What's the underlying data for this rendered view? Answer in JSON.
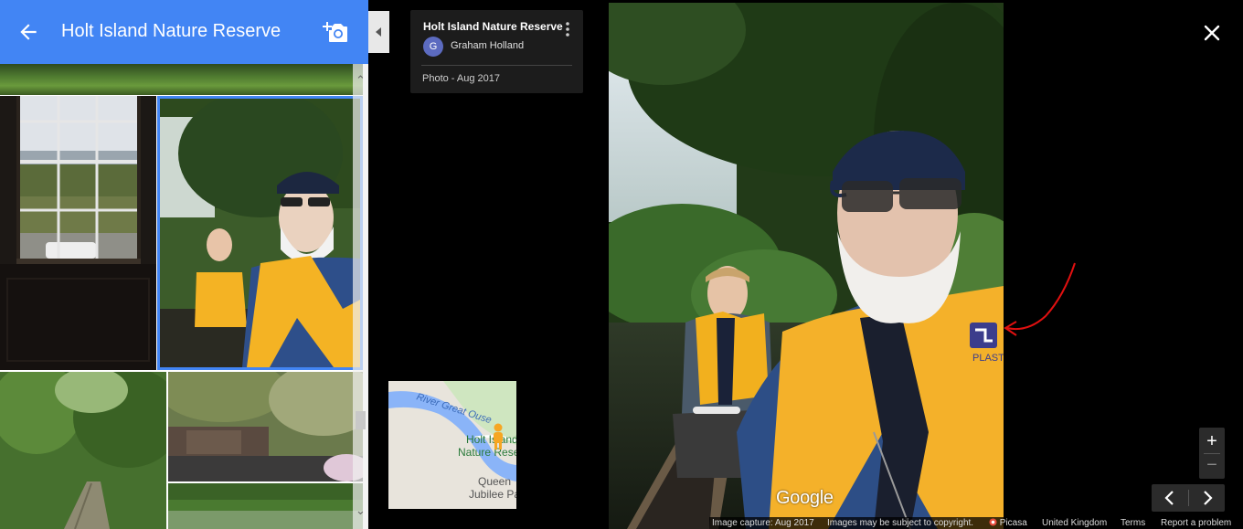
{
  "header": {
    "title": "Holt Island Nature Reserve"
  },
  "info_card": {
    "title": "Holt Island Nature Reserve",
    "author_initial": "G",
    "author_name": "Graham Holland",
    "photo_date": "Photo - Aug 2017"
  },
  "mini_map": {
    "river_label": "River Great Ouse",
    "place_label_line1": "Holt Island",
    "place_label_line2": "Nature Reserve",
    "park_label_line1": "Queen",
    "park_label_line2": "Jubilee Park"
  },
  "photo": {
    "watermark": "Google",
    "vest_brand": "PLASTI"
  },
  "footer": {
    "capture": "Image capture: Aug 2017",
    "copyright": "Images may be subject to copyright.",
    "picasa": "Picasa",
    "region": "United Kingdom",
    "terms": "Terms",
    "report": "Report a problem"
  },
  "controls": {
    "zoom_in": "+",
    "zoom_out": "−"
  },
  "icons": {
    "back": "back-arrow-icon",
    "add_photo": "add-photo-icon",
    "collapse": "collapse-left-icon",
    "more": "more-vertical-icon",
    "close": "close-icon",
    "prev": "chevron-left-icon",
    "next": "chevron-right-icon",
    "pegman": "pegman-icon"
  },
  "colors": {
    "header_bg": "#4285f4",
    "selected_border": "#4285f4",
    "avatar": "#5c6bc0",
    "annotation": "#e01010"
  }
}
